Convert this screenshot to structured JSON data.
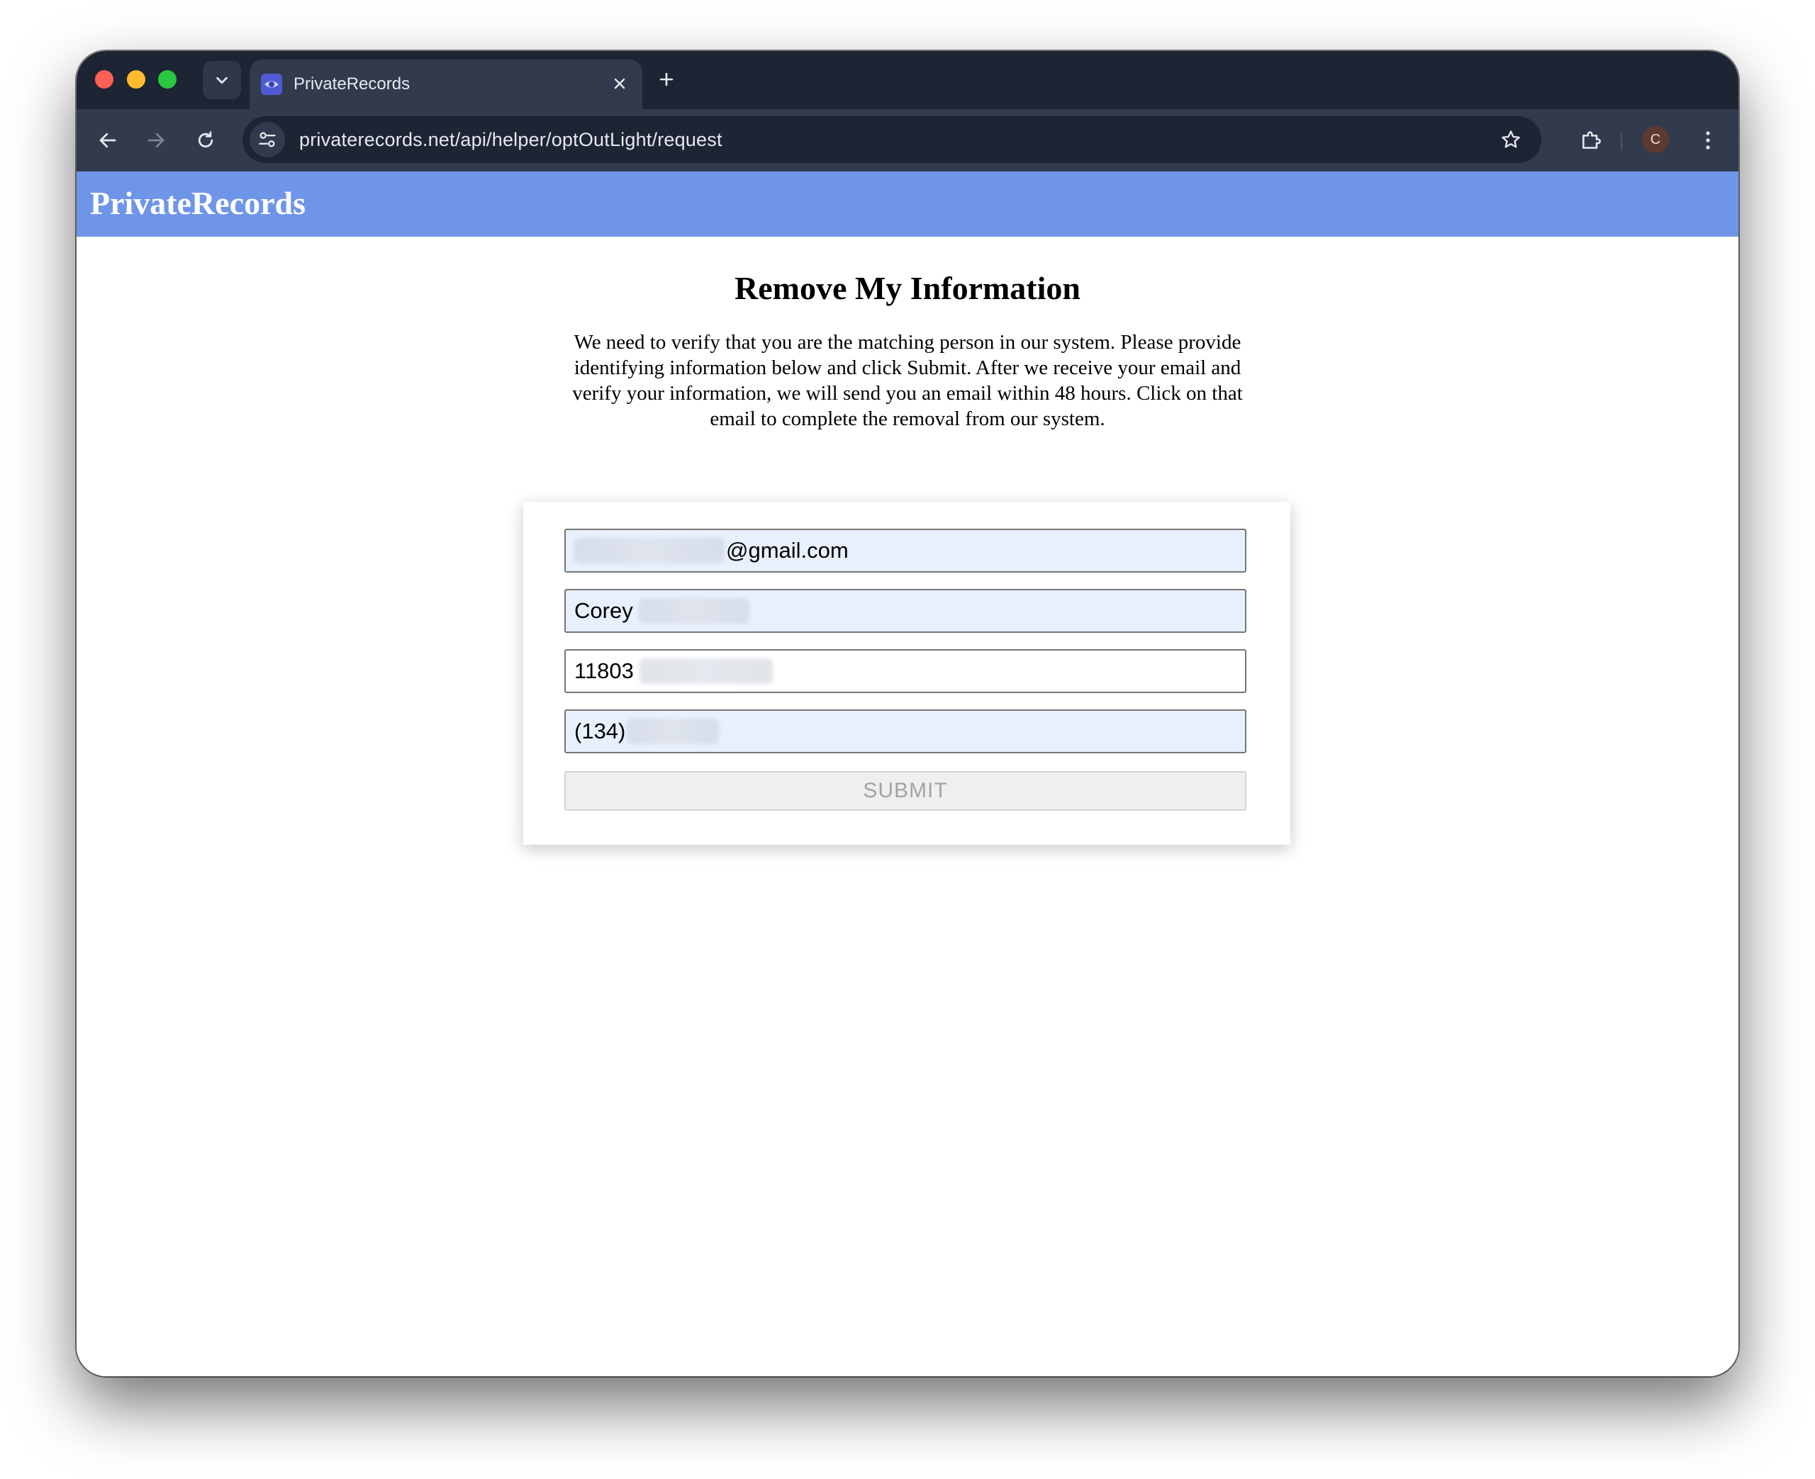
{
  "browser": {
    "tab": {
      "title": "PrivateRecords"
    },
    "address_bar": {
      "url": "privaterecords.net/api/helper/optOutLight/request"
    },
    "profile": {
      "initial": "C"
    }
  },
  "site": {
    "logo": "PrivateRecords",
    "brand_color": "#6f95e8"
  },
  "main": {
    "title": "Remove My Information",
    "intro": "We need to verify that you are the matching person in our system. Please provide identifying information below and click Submit. After we receive your email and verify your information, we will send you an email within 48 hours. Click on that email to complete the removal from our system."
  },
  "form": {
    "email": {
      "value": "@gmail.com"
    },
    "name": {
      "value": "Corey"
    },
    "zip": {
      "value": "11803"
    },
    "phone": {
      "value": "(134)"
    },
    "submit_label": "SUBMIT",
    "autofill_color": "#e8f0fe"
  }
}
